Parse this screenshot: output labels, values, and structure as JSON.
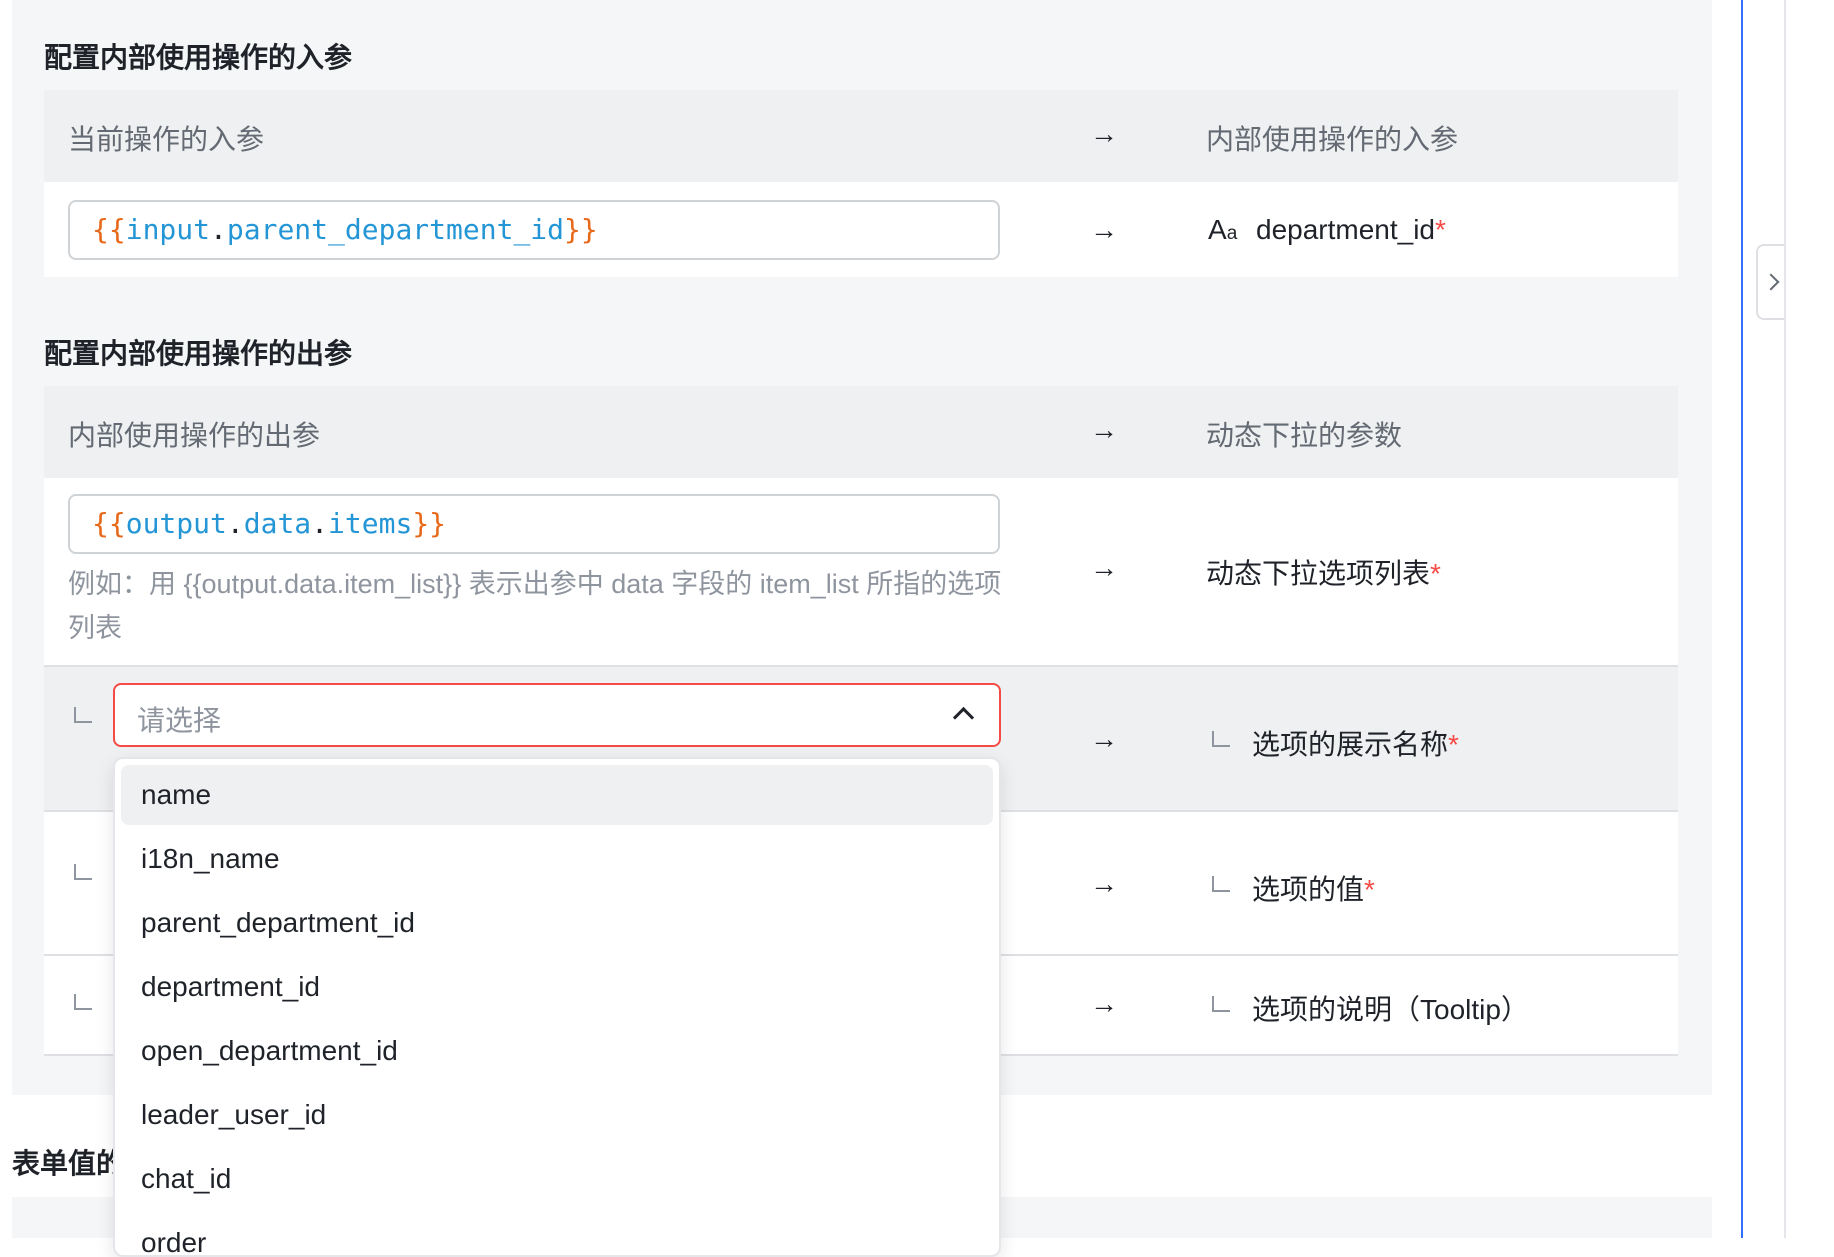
{
  "input_section": {
    "title": "配置内部使用操作的入参",
    "header_left": "当前操作的入参",
    "header_arrow": "→",
    "header_right": "内部使用操作的入参",
    "row": {
      "value_open": "{{",
      "value_var1": "input",
      "value_dot": ".",
      "value_var2": "parent_department_id",
      "value_close": "}}",
      "arrow": "→",
      "type_icon": "text-type-icon",
      "type_big": "A",
      "type_small": "a",
      "param": "department_id",
      "required": "*"
    }
  },
  "output_section": {
    "title": "配置内部使用操作的出参",
    "header_left": "内部使用操作的出参",
    "header_arrow": "→",
    "header_right": "动态下拉的参数",
    "list_row": {
      "value_open": "{{",
      "value_var1": "output",
      "value_dot1": ".",
      "value_var2": "data",
      "value_dot2": ".",
      "value_var3": "items",
      "value_close": "}}",
      "hint": "例如：用 {{output.data.item_list}} 表示出参中 data 字段的 item_list 所指的选项列表",
      "arrow": "→",
      "target": "动态下拉选项列表",
      "required": "*"
    },
    "sub_rows": [
      {
        "select_placeholder": "请选择",
        "arrow": "→",
        "target": "选项的展示名称",
        "required": "*"
      },
      {
        "arrow": "→",
        "target": "选项的值",
        "required": "*"
      },
      {
        "arrow": "→",
        "target": "选项的说明（Tooltip）",
        "required": ""
      }
    ]
  },
  "dropdown": {
    "options": [
      "name",
      "i18n_name",
      "parent_department_id",
      "department_id",
      "open_department_id",
      "leader_user_id",
      "chat_id",
      "order"
    ],
    "highlighted_index": 0
  },
  "bottom_section": {
    "title": "表单值的"
  },
  "colors": {
    "brace": "#e8681a",
    "variable": "#2496d6",
    "required": "#f54a45",
    "accent": "#3370ff"
  }
}
